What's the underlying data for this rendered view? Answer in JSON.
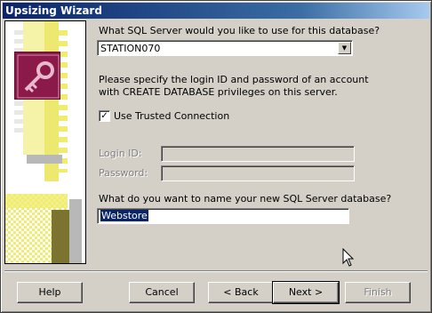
{
  "window": {
    "title": "Upsizing Wizard"
  },
  "server": {
    "question": "What SQL Server would you like to use for this database?",
    "selected": "STATION070"
  },
  "login": {
    "instructions_line1": "Please specify the login ID and password of an account",
    "instructions_line2": "with CREATE DATABASE privileges on this server.",
    "trusted_label": "Use Trusted Connection",
    "trusted_checked": "✓",
    "login_id_label": "Login ID:",
    "password_label": "Password:"
  },
  "database": {
    "question": "What do you want to name your new SQL Server database?",
    "name": "Webstore"
  },
  "buttons": {
    "help": "Help",
    "cancel": "Cancel",
    "back": "< Back",
    "next": "Next >",
    "finish": "Finish"
  },
  "colors": {
    "title_bar": "#0a246a",
    "access_icon": "#8b1a4a",
    "art_yellow": "#f0ec70",
    "dialog_bg": "#d4d0c8"
  }
}
